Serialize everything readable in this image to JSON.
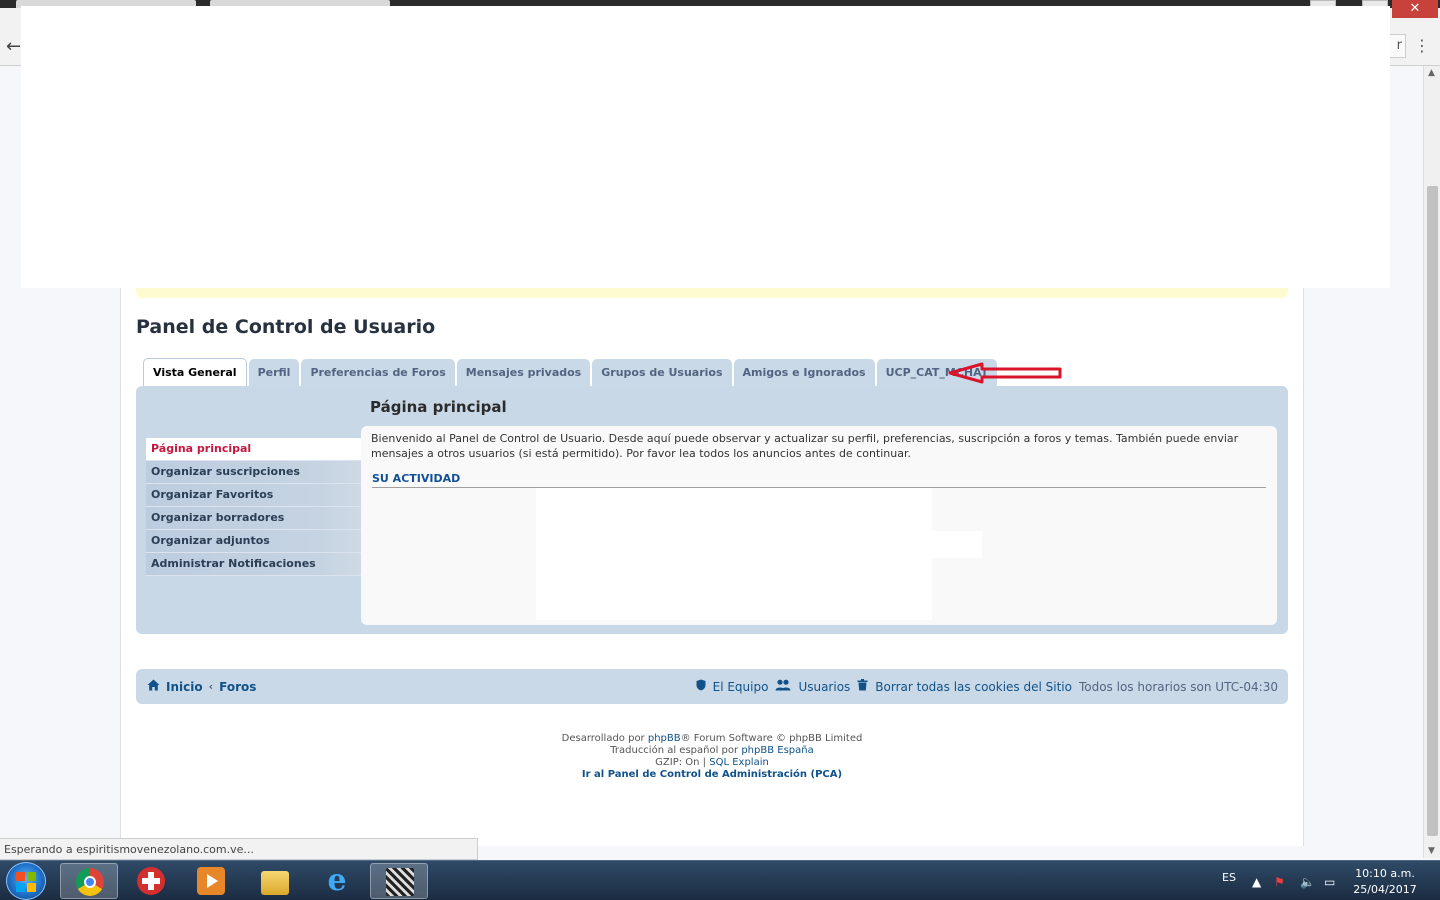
{
  "browser": {
    "back_icon": "arrow-left-icon",
    "menu_icon": "three-dots-icon",
    "ext_label": "r",
    "close_label": "✕",
    "status_text": "Esperando a espiritismovenezolano.com.ve..."
  },
  "page": {
    "title": "Panel de Control de Usuario"
  },
  "tabs": [
    {
      "label": "Vista General",
      "active": true
    },
    {
      "label": "Perfil"
    },
    {
      "label": "Preferencias de Foros"
    },
    {
      "label": "Mensajes privados"
    },
    {
      "label": "Grupos de Usuarios"
    },
    {
      "label": "Amigos e Ignorados"
    },
    {
      "label": "UCP_CAT_MCHAT"
    }
  ],
  "sidebar": {
    "items": [
      {
        "label": "Página principal",
        "active": true
      },
      {
        "label": "Organizar suscripciones"
      },
      {
        "label": "Organizar Favoritos"
      },
      {
        "label": "Organizar borradores"
      },
      {
        "label": "Organizar adjuntos"
      },
      {
        "label": "Administrar Notificaciones"
      }
    ]
  },
  "main": {
    "section_title": "Página principal",
    "welcome_text": "Bienvenido al Panel de Control de Usuario. Desde aquí puede observar y actualizar su perfil, preferencias, suscripción a foros y temas. También puede enviar mensajes a otros usuarios (si está permitido). Por favor lea todos los anuncios antes de continuar.",
    "activity_heading": "SU ACTIVIDAD"
  },
  "footer_nav": {
    "home": "Inicio",
    "chevron": "‹",
    "forums": "Foros",
    "team": "El Equipo",
    "users": "Usuarios",
    "delete_cookies": "Borrar todas las cookies del Sitio",
    "timezone": "Todos los horarios son UTC-04:30"
  },
  "copyright": {
    "line1_prefix": "Desarrollado por ",
    "line1_link": "phpBB",
    "line1_suffix": "® Forum Software © phpBB Limited",
    "line2_prefix": "Traducción al español por ",
    "line2_link": "phpBB España",
    "line3_prefix": "GZIP: On | ",
    "line3_link": "SQL Explain",
    "line4": "Ir al Panel de Control de Administración (PCA)"
  },
  "taskbar": {
    "language": "ES",
    "time": "10:10 a.m.",
    "date": "25/04/2017",
    "apps": [
      "chrome-icon",
      "app-red-icon",
      "media-player-icon",
      "file-explorer-icon",
      "internet-explorer-icon",
      "qr-image-icon"
    ]
  },
  "colors": {
    "accent_red": "#d9142b",
    "link_blue": "#105289",
    "panel_bg": "#c9d8e6",
    "active_nav_text": "#c3183f"
  }
}
